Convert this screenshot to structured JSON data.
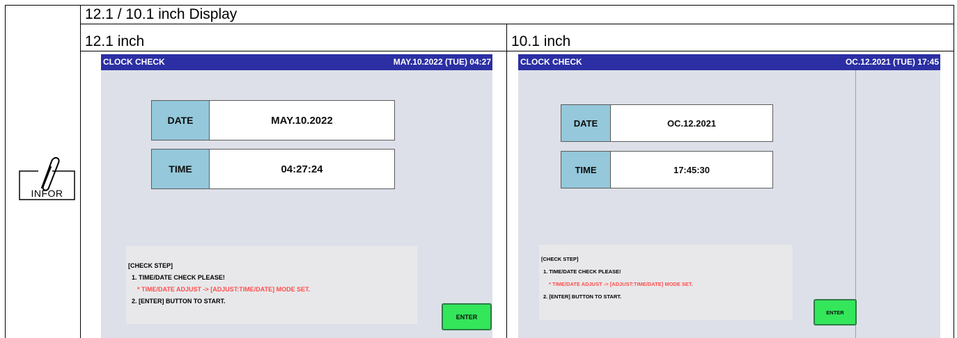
{
  "doc": {
    "header_title": "12.1 / 10.1 inch Display",
    "col_12_label": "12.1 inch",
    "col_10_label": "10.1 inch",
    "infor_label": "INFOR"
  },
  "screen_12": {
    "title": "CLOCK CHECK",
    "datetime": "MAY.10.2022 (TUE)  04:27",
    "date_label": "DATE",
    "date_value": "MAY.10.2022",
    "time_label": "TIME",
    "time_value": "04:27:24",
    "check_step_title": "[CHECK STEP]",
    "step1": "1. TIME/DATE CHECK PLEASE!",
    "step1_note": "* TIME/DATE ADJUST -> [ADJUST:TIME/DATE] MODE SET.",
    "step2": "2. [ENTER] BUTTON TO START.",
    "enter_label": "ENTER"
  },
  "screen_10": {
    "title": "CLOCK CHECK",
    "datetime": "OC.12.2021 (TUE)  17:45",
    "date_label": "DATE",
    "date_value": "OC.12.2021",
    "time_label": "TIME",
    "time_value": "17:45:30",
    "check_step_title": "[CHECK STEP]",
    "step1": "1. TIME/DATE CHECK PLEASE!",
    "step1_note": "* TIME/DATE ADJUST -> [ADJUST:TIME/DATE] MODE SET.",
    "step2": "2. [ENTER] BUTTON TO START.",
    "enter_label": "ENTER"
  },
  "colors": {
    "title_bar": "#2b2fa3",
    "screen_bg": "#dde0e8",
    "label_bg": "#94c8da",
    "note_red": "#ff4d4d",
    "enter_green": "#33e65a"
  }
}
